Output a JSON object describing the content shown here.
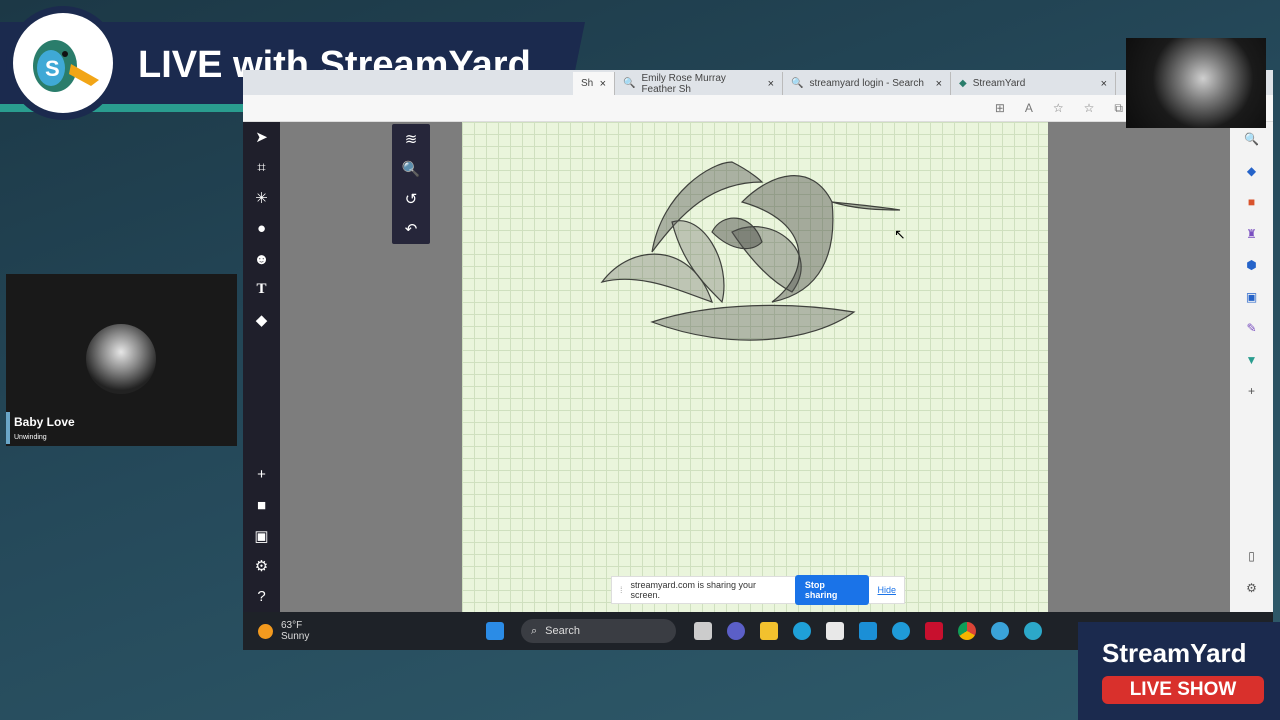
{
  "banner": {
    "title": "LIVE with StreamYard",
    "logo_letter": "S"
  },
  "browser": {
    "tabs": [
      {
        "label": "Sh",
        "partial": true
      },
      {
        "label": "Emily Rose Murray Feather Sh"
      },
      {
        "label": "streamyard login - Search"
      },
      {
        "label": "StreamYard"
      }
    ],
    "close_glyph": "×"
  },
  "sharebar": {
    "message": "streamyard.com is sharing your screen.",
    "stop_label": "Stop sharing",
    "hide_label": "Hide"
  },
  "taskbar": {
    "temp": "63°F",
    "condition": "Sunny",
    "search_label": "Search"
  },
  "participant": {
    "name": "Baby Love",
    "status": "Unwinding"
  },
  "brand": {
    "name": "StreamYard",
    "badge": "LIVE SHOW"
  },
  "colors": {
    "banner": "#1b2a4e",
    "accent": "#2a9d8f",
    "live": "#d9302c",
    "canvas": "#eaf5dc"
  }
}
